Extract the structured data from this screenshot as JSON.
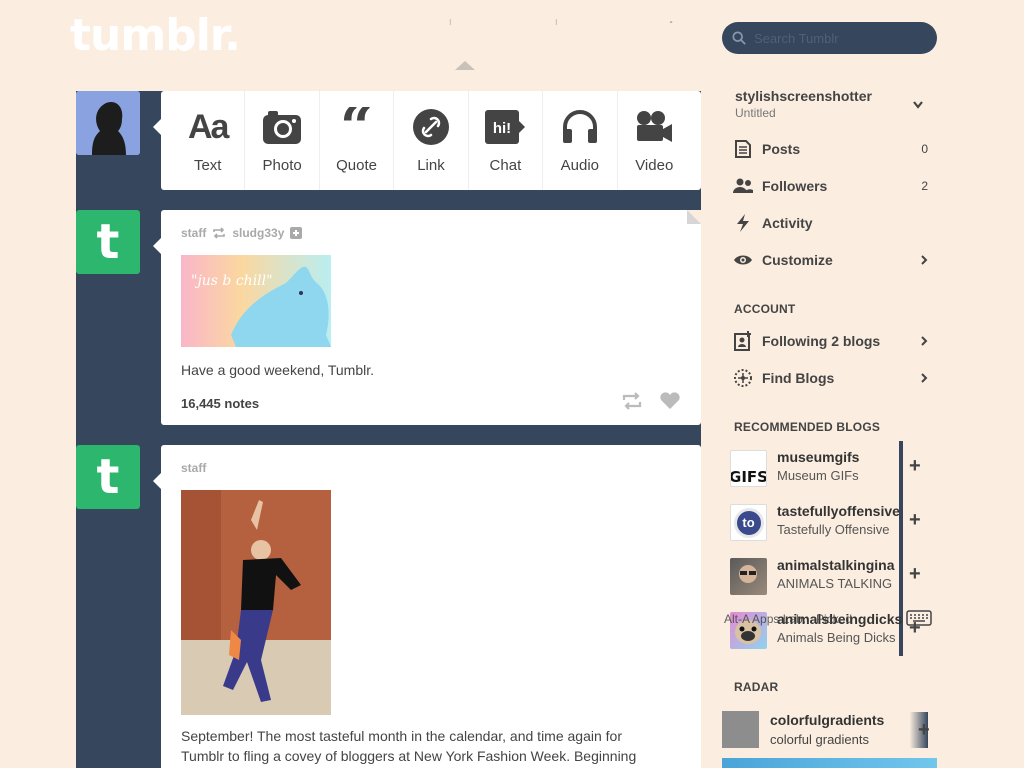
{
  "header": {
    "logo": "tumblr.",
    "search_placeholder": "Search Tumblr"
  },
  "post_types": [
    {
      "label": "Text",
      "icon": "text-icon"
    },
    {
      "label": "Photo",
      "icon": "camera-icon"
    },
    {
      "label": "Quote",
      "icon": "quote-icon"
    },
    {
      "label": "Link",
      "icon": "link-icon"
    },
    {
      "label": "Chat",
      "icon": "chat-icon"
    },
    {
      "label": "Audio",
      "icon": "headphones-icon"
    },
    {
      "label": "Video",
      "icon": "video-camera-icon"
    }
  ],
  "posts": [
    {
      "author": "staff",
      "reblogged_from": "sludg33y",
      "image_caption": "\"jus b chill\"",
      "text": "Have a good weekend, Tumblr.",
      "notes": "16,445 notes"
    },
    {
      "author": "staff",
      "text_line1": "September! The most tasteful month in the calendar, and time again for",
      "text_line2": "Tumblr to fling a covey of bloggers at New York Fashion Week. Beginning"
    }
  ],
  "sidebar": {
    "account_name": "stylishscreenshotter",
    "account_sub": "Untitled",
    "menu": [
      {
        "label": "Posts",
        "count": "0",
        "icon": "posts-icon"
      },
      {
        "label": "Followers",
        "count": "2",
        "icon": "followers-icon"
      },
      {
        "label": "Activity",
        "icon": "lightning-icon"
      },
      {
        "label": "Customize",
        "icon": "eye-icon"
      }
    ],
    "account_heading": "ACCOUNT",
    "account_items": [
      {
        "label": "Following 2 blogs",
        "icon": "following-icon"
      },
      {
        "label": "Find Blogs",
        "icon": "compass-icon"
      }
    ],
    "recommended_heading": "RECOMMENDED BLOGS",
    "recommended": [
      {
        "name": "museumgifs",
        "title": "Museum GIFs",
        "thumb_text": "GIFS"
      },
      {
        "name": "tastefullyoffensive",
        "title": "Tastefully Offensive",
        "thumb_text": "to"
      },
      {
        "name": "animalstalkingina",
        "title": "ANIMALS TALKING",
        "thumb_text": ""
      },
      {
        "name": "animalsbeingdicks",
        "title": "Animals Being Dicks",
        "thumb_text": ""
      }
    ],
    "overlay_text": "Alt-A  Apps  Lab...  Picked",
    "radar_heading": "RADAR",
    "radar": {
      "name": "colorfulgradients",
      "title": "colorful gradients"
    }
  },
  "colors": {
    "background": "#fbeee0",
    "navy": "#36465d",
    "tumblr_green": "#2cb66e"
  }
}
